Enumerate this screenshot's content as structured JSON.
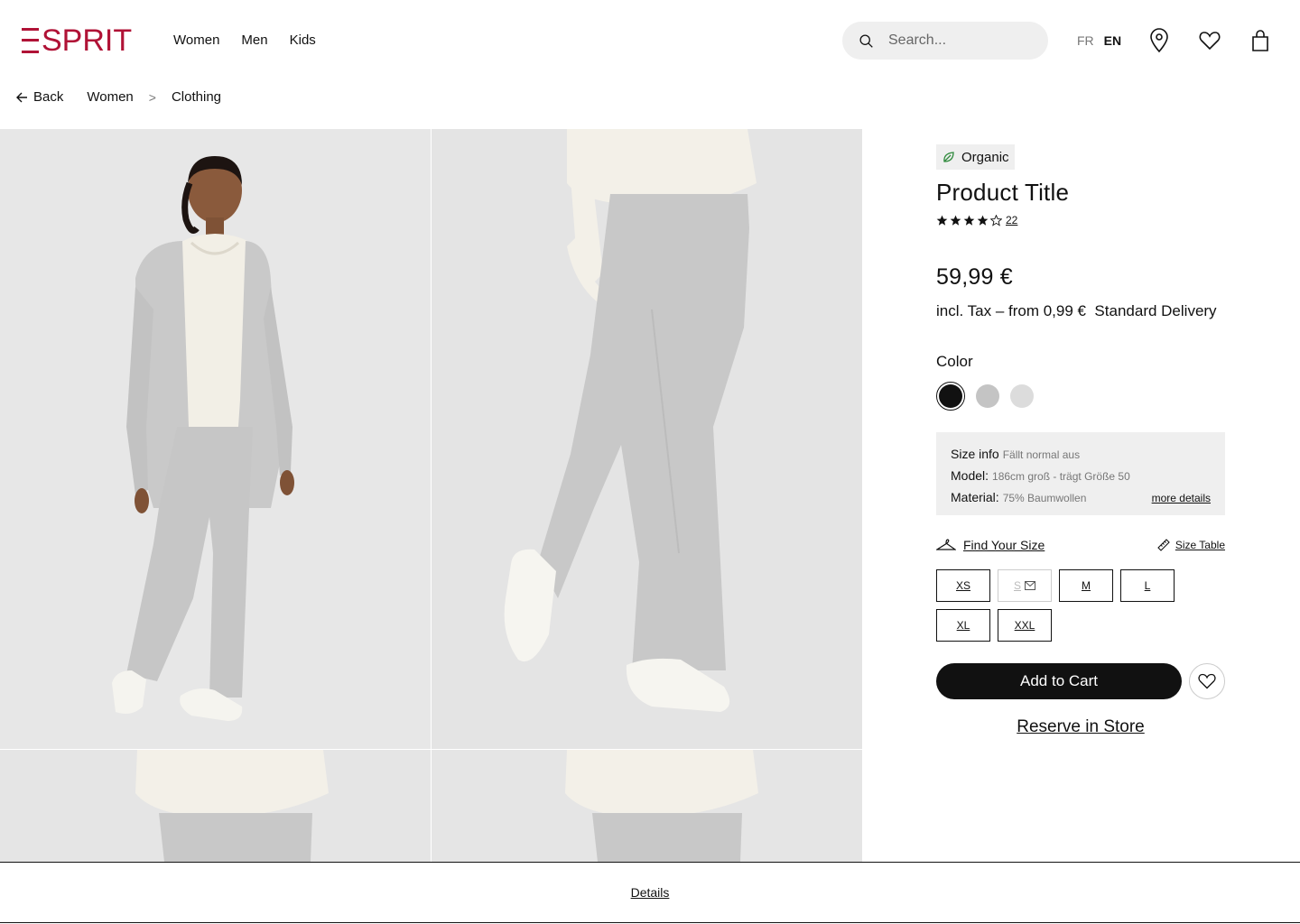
{
  "header": {
    "logo": "ESPRIT",
    "nav": [
      "Women",
      "Men",
      "Kids"
    ],
    "search_placeholder": "Search...",
    "lang_fr": "FR",
    "lang_en": "EN"
  },
  "breadcrumb": {
    "back": "Back",
    "items": [
      "Women",
      "Clothing"
    ],
    "separator": ">"
  },
  "product": {
    "badge": "Organic",
    "title": "Product Title",
    "rating": 4,
    "rating_max": 5,
    "review_count": "22",
    "price": "59,99 €",
    "tax_line": "incl. Tax – from 0,99 €  Standard Delivery",
    "color_label": "Color",
    "colors": [
      "#111111",
      "#c4c4c4",
      "#dcdcdc"
    ],
    "size_info": {
      "label": "Size info",
      "fit": "Fällt normal aus",
      "model_label": "Model:",
      "model_value": "186cm groß - trägt Größe 50",
      "material_label": "Material:",
      "material_value": "75% Baumwollen",
      "more": "more details"
    },
    "find_size": "Find Your Size",
    "size_table": "Size Table",
    "sizes": [
      "XS",
      "S",
      "M",
      "L",
      "XL",
      "XXL"
    ],
    "add_to_cart": "Add to Cart",
    "reserve": "Reserve in Store"
  },
  "details": "Details",
  "theme": {
    "brand": "#b01236",
    "dark": "#111111",
    "panel_bg": "#efefef"
  }
}
